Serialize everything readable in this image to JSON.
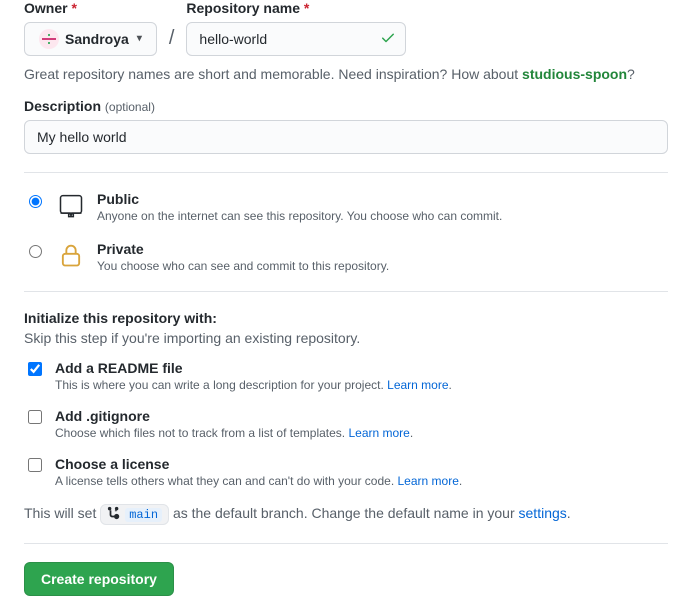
{
  "owner": {
    "label": "Owner",
    "selected": "Sandroya"
  },
  "repo": {
    "label": "Repository name",
    "value": "hello-world"
  },
  "helper": {
    "prefix": "Great repository names are short and memorable. Need inspiration? How about ",
    "suggestion": "studious-spoon",
    "suffix": "?"
  },
  "description": {
    "label": "Description",
    "optional": "(optional)",
    "value": "My hello world"
  },
  "visibility": {
    "public": {
      "title": "Public",
      "desc": "Anyone on the internet can see this repository. You choose who can commit."
    },
    "private": {
      "title": "Private",
      "desc": "You choose who can see and commit to this repository."
    }
  },
  "init": {
    "heading": "Initialize this repository with:",
    "subheading": "Skip this step if you're importing an existing repository.",
    "readme": {
      "title": "Add a README file",
      "desc": "This is where you can write a long description for your project. ",
      "link": "Learn more"
    },
    "gitignore": {
      "title": "Add .gitignore",
      "desc": "Choose which files not to track from a list of templates. ",
      "link": "Learn more"
    },
    "license": {
      "title": "Choose a license",
      "desc": "A license tells others what they can and can't do with your code. ",
      "link": "Learn more"
    }
  },
  "branch": {
    "prefix": "This will set ",
    "name": "main",
    "mid": " as the default branch. Change the default name in your ",
    "link": "settings",
    "suffix": "."
  },
  "submit": {
    "label": "Create repository"
  }
}
